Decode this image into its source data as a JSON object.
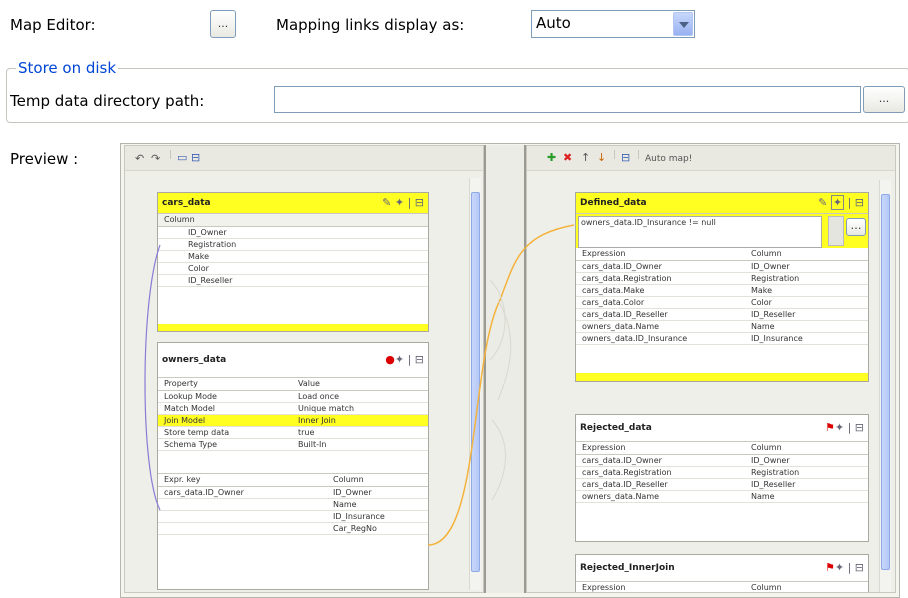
{
  "settings": {
    "map_editor_label": "Map Editor:",
    "map_editor_button": "...",
    "mapping_links_label": "Mapping links display as:",
    "mapping_links_value": "Auto",
    "store_group_label": "Store on disk",
    "temp_dir_label": "Temp data directory path:",
    "temp_dir_value": "",
    "temp_dir_button": "...",
    "preview_label": "Preview :"
  },
  "left_pane": {
    "toolbar_text": "",
    "cars_table": {
      "name": "cars_data",
      "header": "Column",
      "rows": [
        "ID_Owner",
        "Registration",
        "Make",
        "Color",
        "ID_Reseller"
      ]
    },
    "owners_table": {
      "name": "owners_data",
      "props_header": [
        "Property",
        "Value"
      ],
      "props": [
        [
          "Lookup Mode",
          "Load once"
        ],
        [
          "Match Model",
          "Unique match"
        ],
        [
          "Join Model",
          "Inner Join"
        ],
        [
          "Store temp data",
          "true"
        ],
        [
          "Schema Type",
          "Built-In"
        ]
      ],
      "key_header": [
        "Expr. key",
        "Column"
      ],
      "keys": [
        [
          "cars_data.ID_Owner",
          "ID_Owner"
        ],
        [
          "",
          "Name"
        ],
        [
          "",
          "ID_Insurance"
        ],
        [
          "",
          "Car_RegNo"
        ]
      ]
    }
  },
  "right_pane": {
    "toolbar_text": "Auto map!",
    "defined_table": {
      "name": "Defined_data",
      "filter_text": "owners_data.ID_Insurance != null",
      "header": [
        "Expression",
        "Column"
      ],
      "rows": [
        [
          "cars_data.ID_Owner",
          "ID_Owner"
        ],
        [
          "cars_data.Registration",
          "Registration"
        ],
        [
          "cars_data.Make",
          "Make"
        ],
        [
          "cars_data.Color",
          "Color"
        ],
        [
          "cars_data.ID_Reseller",
          "ID_Reseller"
        ],
        [
          "owners_data.Name",
          "Name"
        ],
        [
          "owners_data.ID_Insurance",
          "ID_Insurance"
        ]
      ]
    },
    "rejected_table": {
      "name": "Rejected_data",
      "header": [
        "Expression",
        "Column"
      ],
      "rows": [
        [
          "cars_data.ID_Owner",
          "ID_Owner"
        ],
        [
          "cars_data.Registration",
          "Registration"
        ],
        [
          "cars_data.ID_Reseller",
          "ID_Reseller"
        ],
        [
          "owners_data.Name",
          "Name"
        ]
      ]
    },
    "rejected_inner_table": {
      "name": "Rejected_InnerJoin",
      "header": [
        "Expression",
        "Column"
      ]
    }
  }
}
